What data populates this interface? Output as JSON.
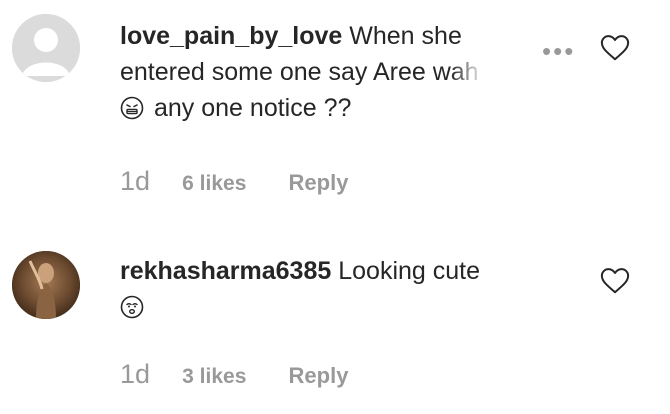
{
  "comments": [
    {
      "username": "love_pain_by_love",
      "text_lead": "When she entered some one say Aree",
      "text_fade": "wah",
      "text_tail": "any one notice ??",
      "time": "1d",
      "likes": "6 likes",
      "reply_label": "Reply",
      "avatar_icon": "default-avatar-icon",
      "emoji_icon": "grimacing-face-icon"
    },
    {
      "username": "rekhasharma6385",
      "text_lead": "Looking cute",
      "time": "1d",
      "likes": "3 likes",
      "reply_label": "Reply",
      "avatar_icon": "user-photo",
      "emoji_icon": "face-icon"
    }
  ],
  "icons": {
    "more": "more-options-icon",
    "like": "heart-icon"
  },
  "colors": {
    "text": "#262626",
    "meta": "#8e8e8e",
    "avatar_default": "#dbdbdb"
  }
}
